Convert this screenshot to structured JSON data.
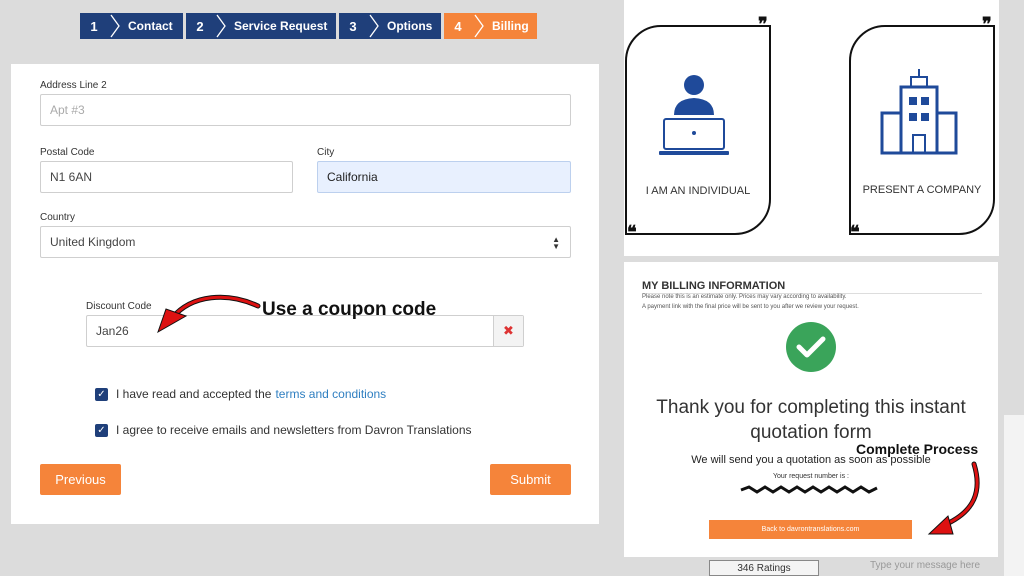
{
  "stepper": [
    {
      "num": "1",
      "label": "Contact"
    },
    {
      "num": "2",
      "label": "Service Request"
    },
    {
      "num": "3",
      "label": "Options"
    },
    {
      "num": "4",
      "label": "Billing"
    }
  ],
  "form": {
    "address2": {
      "label": "Address Line 2",
      "placeholder": "Apt #3"
    },
    "postal": {
      "label": "Postal Code",
      "value": "N1 6AN"
    },
    "city": {
      "label": "City",
      "value": "California"
    },
    "country": {
      "label": "Country",
      "value": "United Kingdom"
    },
    "discount": {
      "label": "Discount Code",
      "value": "Jan26",
      "clear": "✖"
    },
    "terms": {
      "text": "I have read and accepted the",
      "link": "terms and conditions"
    },
    "newsletter": {
      "text": "I agree to receive emails and newsletters from Davron Translations"
    },
    "previous": "Previous",
    "submit": "Submit"
  },
  "annotations": {
    "coupon": "Use a coupon code",
    "complete": "Complete Process"
  },
  "choices": {
    "individual": "I AM AN INDIVIDUAL",
    "company": "PRESENT A COMPANY"
  },
  "billing": {
    "title": "MY BILLING INFORMATION",
    "note1": "Please note this is an estimate only. Prices may vary according to availability.",
    "note2": "A payment link with the final price will be sent to you after we review your request.",
    "thanks1": "Thank you for completing this instant",
    "thanks2": "quotation form",
    "send": "We will send you a quotation as soon as possible",
    "request": "Your request number is :",
    "back": "Back to davrontranslations.com"
  },
  "footer": {
    "ratings": "346 Ratings",
    "message_placeholder": "Type your message here"
  },
  "colors": {
    "navy": "#1f3f7a",
    "orange": "#f5843a",
    "green": "#3aa45a",
    "arrow_red": "#d11"
  }
}
